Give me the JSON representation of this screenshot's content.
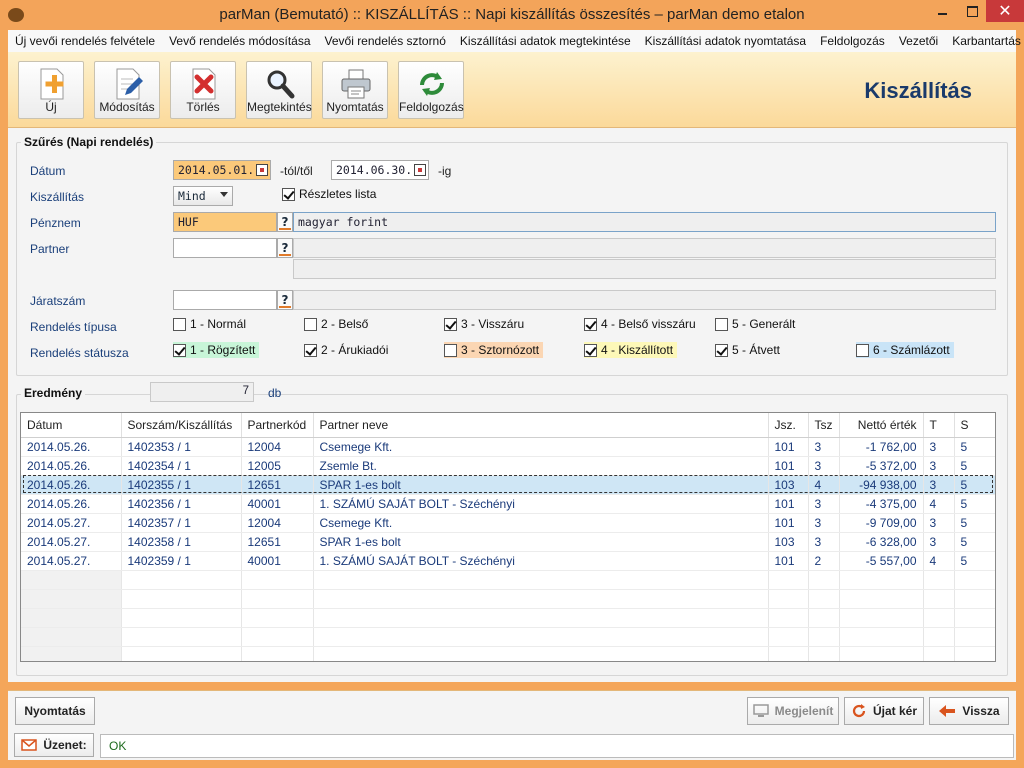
{
  "window": {
    "title": "parMan (Bemutató) :: KISZÁLLÍTÁS :: Napi kiszállítás összesítés   –   parMan demo etalon",
    "close_label": "✕"
  },
  "menu": [
    "Új vevői rendelés felvétele",
    "Vevő rendelés módosítása",
    "Vevői rendelés sztornó",
    "Kiszállítási adatok megtekintése",
    "Kiszállítási adatok nyomtatása",
    "Feldolgozás",
    "Vezetői",
    "Karbantartás"
  ],
  "toolbar": {
    "new": "Új",
    "edit": "Módosítás",
    "delete": "Törlés",
    "view": "Megtekintés",
    "print": "Nyomtatás",
    "process": "Feldolgozás",
    "heading": "Kiszállítás"
  },
  "filter": {
    "group_title": "Szűrés (Napi rendelés)",
    "date_label": "Dátum",
    "date_from": "2014.05.01.",
    "date_from_suffix": "-tól/től",
    "date_to": "2014.06.30.",
    "date_to_suffix": "-ig",
    "delivery_label": "Kiszállítás",
    "delivery_value": "Mind",
    "detailed_list": "Részletes lista",
    "currency_label": "Pénznem",
    "currency_code": "HUF",
    "currency_name": "magyar forint",
    "lookup": "?",
    "partner_label": "Partner",
    "route_label": "Járatszám",
    "order_type_label": "Rendelés típusa",
    "order_types": [
      "1 - Normál",
      "2 - Belső",
      "3 - Visszáru",
      "4 - Belső visszáru",
      "5 - Generált"
    ],
    "order_types_checked": [
      false,
      false,
      true,
      true,
      false
    ],
    "order_status_label": "Rendelés státusza",
    "order_statuses": [
      "1 - Rögzített",
      "2 - Árukiadói",
      "3 - Sztornózott",
      "4 - Kiszállított",
      "5 - Átvett",
      "6 - Számlázott"
    ],
    "order_statuses_checked": [
      true,
      true,
      false,
      true,
      true,
      false
    ],
    "status_colors": [
      "#c8f5d8",
      "",
      "#fbd6b3",
      "#fdf8b8",
      "",
      "#c9e4f7"
    ]
  },
  "result": {
    "title": "Eredmény",
    "count": "7",
    "unit": "db",
    "columns": [
      "Dátum",
      "Sorszám/Kiszállítás",
      "Partnerkód",
      "Partner neve",
      "Jsz.",
      "Tsz",
      "Nettó érték",
      "T",
      "S"
    ],
    "rows": [
      [
        "2014.05.26.",
        "1402353 / 1",
        "12004",
        "Csemege Kft.",
        "101",
        "3",
        "-1 762,00",
        "3",
        "5"
      ],
      [
        "2014.05.26.",
        "1402354 / 1",
        "12005",
        "Zsemle Bt.",
        "101",
        "3",
        "-5 372,00",
        "3",
        "5"
      ],
      [
        "2014.05.26.",
        "1402355 / 1",
        "12651",
        "SPAR 1-es bolt",
        "103",
        "4",
        "-94 938,00",
        "3",
        "5"
      ],
      [
        "2014.05.26.",
        "1402356 / 1",
        "40001",
        "1. SZÁMÚ SAJÁT BOLT - Széchényi",
        "101",
        "3",
        "-4 375,00",
        "4",
        "5"
      ],
      [
        "2014.05.27.",
        "1402357 / 1",
        "12004",
        "Csemege Kft.",
        "101",
        "3",
        "-9 709,00",
        "3",
        "5"
      ],
      [
        "2014.05.27.",
        "1402358 / 1",
        "12651",
        "SPAR 1-es bolt",
        "103",
        "3",
        "-6 328,00",
        "3",
        "5"
      ],
      [
        "2014.05.27.",
        "1402359 / 1",
        "40001",
        "1. SZÁMÚ SAJÁT BOLT - Széchényi",
        "101",
        "2",
        "-5 557,00",
        "4",
        "5"
      ]
    ],
    "selected_row": 2
  },
  "bottom": {
    "print": "Nyomtatás",
    "display": "Megjelenít",
    "refresh": "Újat kér",
    "back": "Vissza"
  },
  "status": {
    "label": "Üzenet:",
    "value": "OK"
  }
}
